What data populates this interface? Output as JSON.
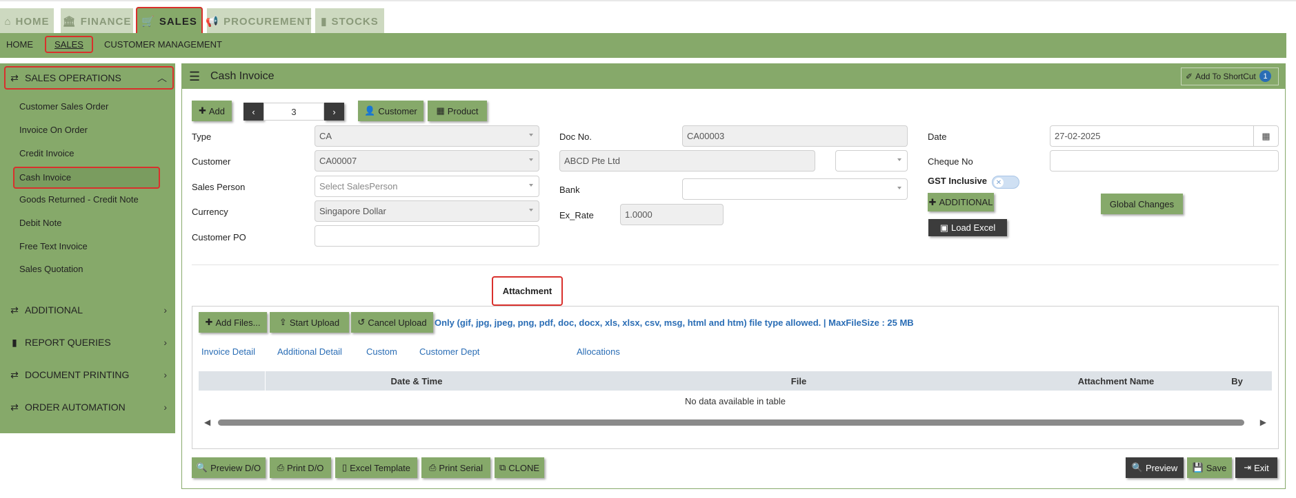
{
  "top_tabs": [
    {
      "label": "HOME",
      "icon": "home-icon"
    },
    {
      "label": "FINANCE",
      "icon": "bank-icon"
    },
    {
      "label": "SALES",
      "icon": "cart-icon"
    },
    {
      "label": "PROCUREMENT",
      "icon": "megaphone-icon"
    },
    {
      "label": "STOCKS",
      "icon": "bar-chart-icon"
    }
  ],
  "sub_nav": [
    "HOME",
    "SALES",
    "CUSTOMER MANAGEMENT"
  ],
  "sidebar": {
    "section": "SALES OPERATIONS",
    "items": [
      "Customer Sales Order",
      "Invoice On Order",
      "Credit Invoice",
      "Cash Invoice",
      "Goods Returned - Credit Note",
      "Debit Note",
      "Free Text Invoice",
      "Sales Quotation"
    ],
    "groups": [
      "ADDITIONAL",
      "REPORT QUERIES",
      "DOCUMENT PRINTING",
      "ORDER AUTOMATION"
    ]
  },
  "panel": {
    "title": "Cash Invoice",
    "shortcut_label": "Add To ShortCut",
    "shortcut_badge": "1"
  },
  "toolbar": {
    "add": "Add",
    "record_number": "3",
    "customer": "Customer",
    "product": "Product"
  },
  "form": {
    "type_label": "Type",
    "type_value": "CA",
    "customer_label": "Customer",
    "customer_value": "CA00007",
    "sales_person_label": "Sales Person",
    "sales_person_placeholder": "Select SalesPerson",
    "currency_label": "Currency",
    "currency_value": "Singapore Dollar",
    "customer_po_label": "Customer PO",
    "customer_po_value": "",
    "doc_no_label": "Doc No.",
    "doc_no_value": "CA00003",
    "customer_name_value": "ABCD Pte Ltd",
    "bank_label": "Bank",
    "bank_value": "",
    "ex_rate_label": "Ex_Rate",
    "ex_rate_value": "1.0000",
    "date_label": "Date",
    "date_value": "27-02-2025",
    "cheque_label": "Cheque No",
    "cheque_value": "",
    "gst_label": "GST Inclusive",
    "additional_btn": "ADDITIONAL",
    "load_excel_btn": "Load Excel",
    "global_changes_btn": "Global Changes"
  },
  "tabs": [
    "Invoice Detail",
    "Additional Detail",
    "Custom",
    "Customer Dept",
    "Attachment",
    "Allocations"
  ],
  "attachment": {
    "add_files": "Add Files...",
    "start_upload": "Start Upload",
    "cancel_upload": "Cancel Upload",
    "note": "Only (gif, jpg, jpeg, png, pdf, doc, docx, xls, xlsx, csv, msg, html and htm) file type allowed. | MaxFileSize : 25 MB",
    "columns": [
      "",
      "Date & Time",
      "File",
      "Attachment Name",
      "By"
    ],
    "empty": "No data available in table"
  },
  "bottom": {
    "preview_do": "Preview D/O",
    "print_do": "Print D/O",
    "excel_template": "Excel Template",
    "print_serial": "Print Serial",
    "clone": "CLONE",
    "preview": "Preview",
    "save": "Save",
    "exit": "Exit"
  },
  "colors": {
    "accent": "#86a96a",
    "highlight": "#d9302c",
    "link": "#2a6db5"
  }
}
